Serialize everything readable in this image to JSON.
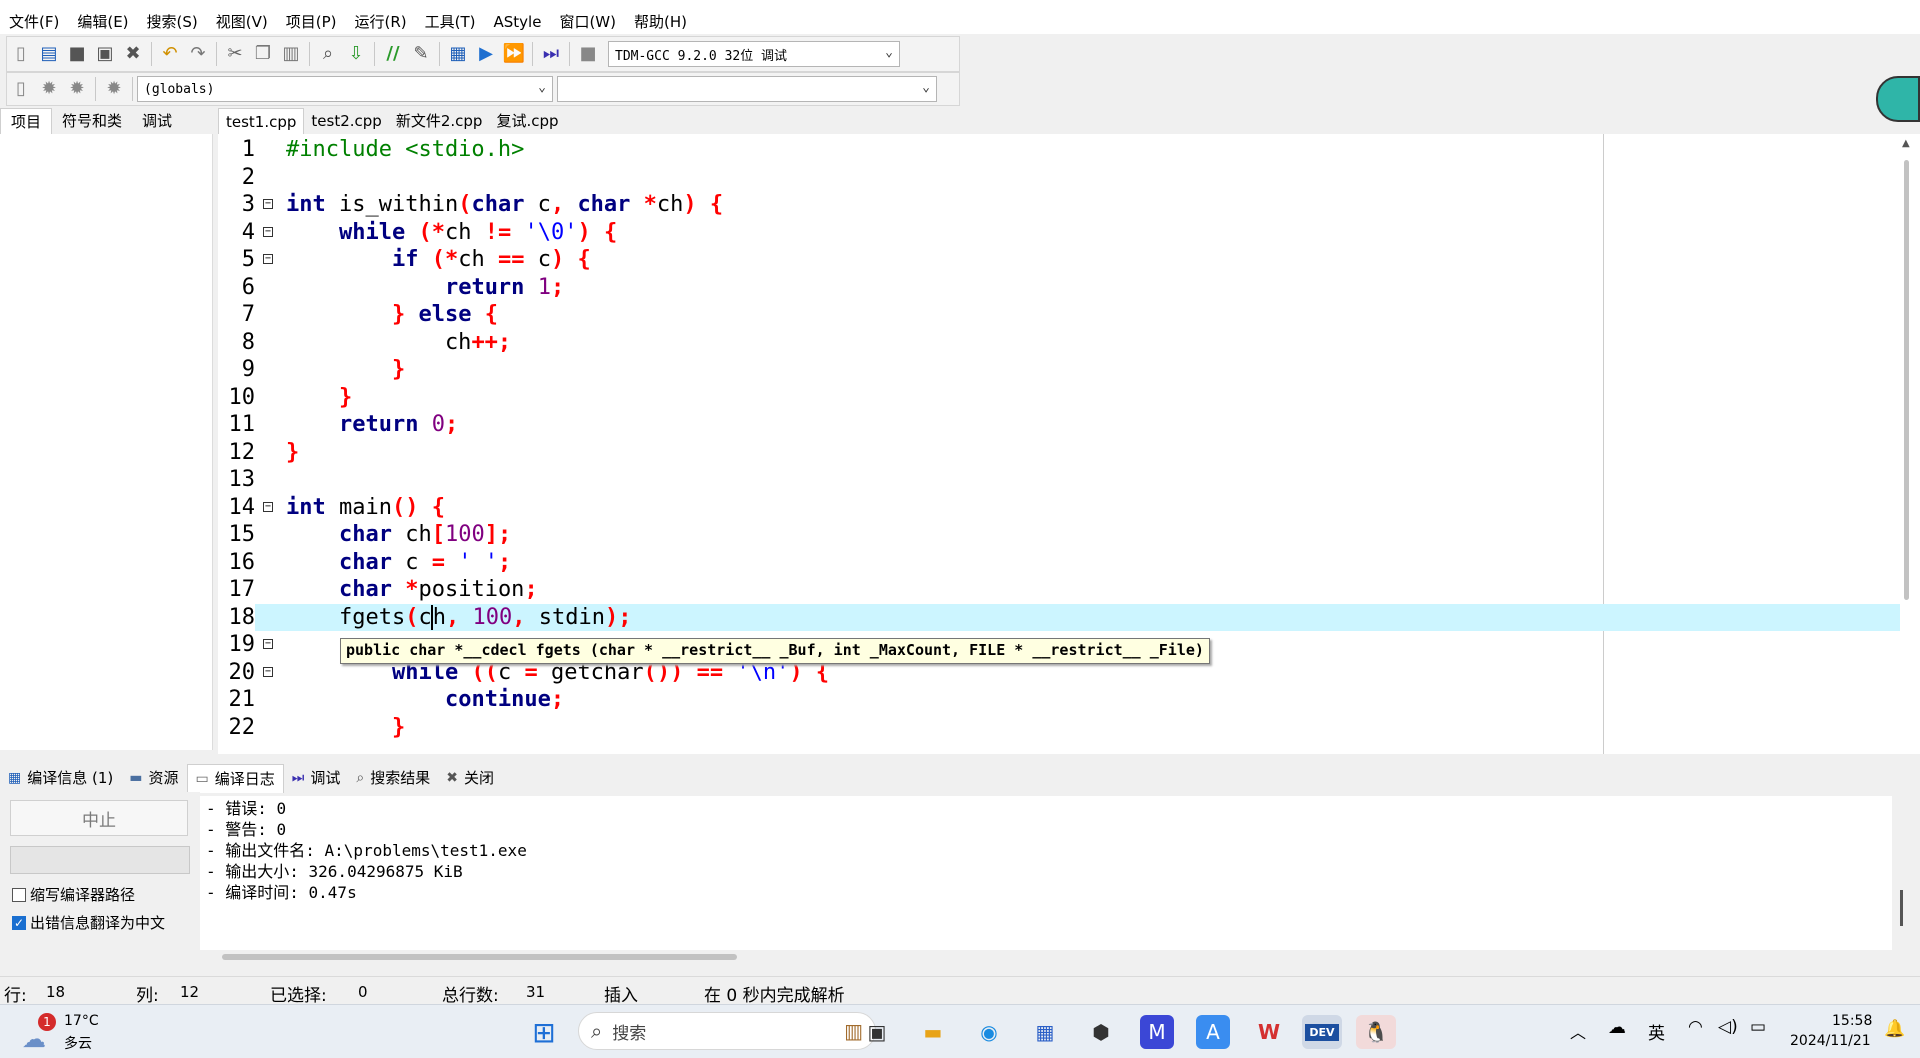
{
  "menu": [
    "文件(F)",
    "编辑(E)",
    "搜索(S)",
    "视图(V)",
    "项目(P)",
    "运行(R)",
    "工具(T)",
    "AStyle",
    "窗口(W)",
    "帮助(H)"
  ],
  "toolbar": {
    "compiler": "TDM-GCC 9.2.0 32位  调试",
    "scope": "(globals)",
    "members": ""
  },
  "side_tabs": [
    "项目",
    "符号和类",
    "调试"
  ],
  "editor_tabs": [
    "test1.cpp",
    "test2.cpp",
    "新文件2.cpp",
    "复试.cpp"
  ],
  "code_lines": [
    {
      "n": "1",
      "fold": ""
    },
    {
      "n": "2",
      "fold": ""
    },
    {
      "n": "3",
      "fold": "⊟"
    },
    {
      "n": "4",
      "fold": "⊟"
    },
    {
      "n": "5",
      "fold": "⊟"
    },
    {
      "n": "6",
      "fold": ""
    },
    {
      "n": "7",
      "fold": ""
    },
    {
      "n": "8",
      "fold": ""
    },
    {
      "n": "9",
      "fold": ""
    },
    {
      "n": "10",
      "fold": ""
    },
    {
      "n": "11",
      "fold": ""
    },
    {
      "n": "12",
      "fold": ""
    },
    {
      "n": "13",
      "fold": ""
    },
    {
      "n": "14",
      "fold": "⊟"
    },
    {
      "n": "15",
      "fold": ""
    },
    {
      "n": "16",
      "fold": ""
    },
    {
      "n": "17",
      "fold": ""
    },
    {
      "n": "18",
      "fold": ""
    },
    {
      "n": "19",
      "fold": "⊟"
    },
    {
      "n": "20",
      "fold": "⊟"
    },
    {
      "n": "21",
      "fold": ""
    },
    {
      "n": "22",
      "fold": ""
    }
  ],
  "tooltip": "public char *__cdecl fgets (char * __restrict__ _Buf, int _MaxCount, FILE * __restrict__ _File)",
  "bottom_tabs": [
    "编译信息 (1)",
    "资源",
    "编译日志",
    "调试",
    "搜索结果",
    "关闭"
  ],
  "compile_panel": {
    "stop_label": "中止",
    "option1": "缩写编译器路径",
    "option2": "出错信息翻译为中文",
    "option1_checked": false,
    "option2_checked": true
  },
  "log_lines": [
    "- 错误: 0",
    "- 警告: 0",
    "- 输出文件名: A:\\problems\\test1.exe",
    "- 输出大小: 326.04296875 KiB",
    "- 编译时间: 0.47s"
  ],
  "status": {
    "row_label": "行:",
    "row": "18",
    "col_label": "列:",
    "col": "12",
    "sel_label": "已选择:",
    "sel": "0",
    "total_label": "总行数:",
    "total": "31",
    "mode": "插入",
    "parse": "在 0 秒内完成解析"
  },
  "taskbar": {
    "weather_temp": "17°C",
    "weather_desc": "多云",
    "weather_badge": "1",
    "search_placeholder": "搜索",
    "ime": "英",
    "time": "15:58",
    "date": "2024/11/21"
  }
}
